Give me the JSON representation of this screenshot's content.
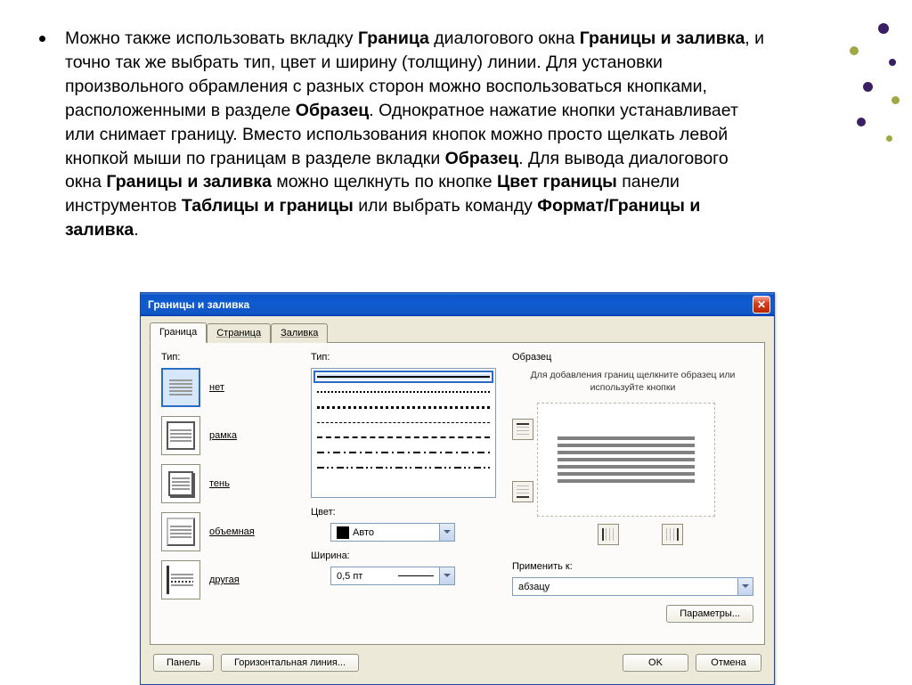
{
  "paragraph": {
    "t1": "Можно также использовать вкладку ",
    "b1": "Граница",
    "t2": " диалогового окна ",
    "b2": "Границы и заливка",
    "t3": ", и точно так же выбрать тип, цвет и ширину (толщину) линии. Для установки произвольного обрамления с разных сторон можно воспользоваться кнопками, расположенными в разделе ",
    "b3": "Образец",
    "t4": ". Однократное нажатие кнопки устанавливает или снимает границу. Вместо использования кнопок можно просто щелкать левой кнопкой мыши по границам в разделе вкладки ",
    "b4": "Образец",
    "t5": ". Для вывода диалогового окна ",
    "b5": "Границы и заливка",
    "t6": " можно щелкнуть по кнопке ",
    "b6": "Цвет границы",
    "t7": " панели инструментов ",
    "b7": "Таблицы и границы",
    "t8": " или выбрать команду ",
    "b8": "Формат/Границы и заливка",
    "t9": "."
  },
  "dialog": {
    "title": "Границы и заливка",
    "close": "✕",
    "tabs": {
      "border": "Граница",
      "page": "Страница",
      "fill": "Заливка"
    },
    "col1": {
      "label": "Тип:",
      "none": "нет",
      "box": "рамка",
      "shadow": "тень",
      "threeD": "объемная",
      "custom": "другая"
    },
    "col2": {
      "lineTypeLabel": "Тип:",
      "colorLabel": "Цвет:",
      "colorValue": "Авто",
      "widthLabel": "Ширина:",
      "widthValue": "0,5 пт"
    },
    "col3": {
      "label": "Образец",
      "hint": "Для добавления границ щелкните образец или используйте кнопки",
      "applyLabel": "Применить к:",
      "applyValue": "абзацу",
      "params": "Параметры..."
    },
    "footer": {
      "panel": "Панель",
      "hline": "Горизонтальная линия...",
      "ok": "OK",
      "cancel": "Отмена"
    }
  }
}
